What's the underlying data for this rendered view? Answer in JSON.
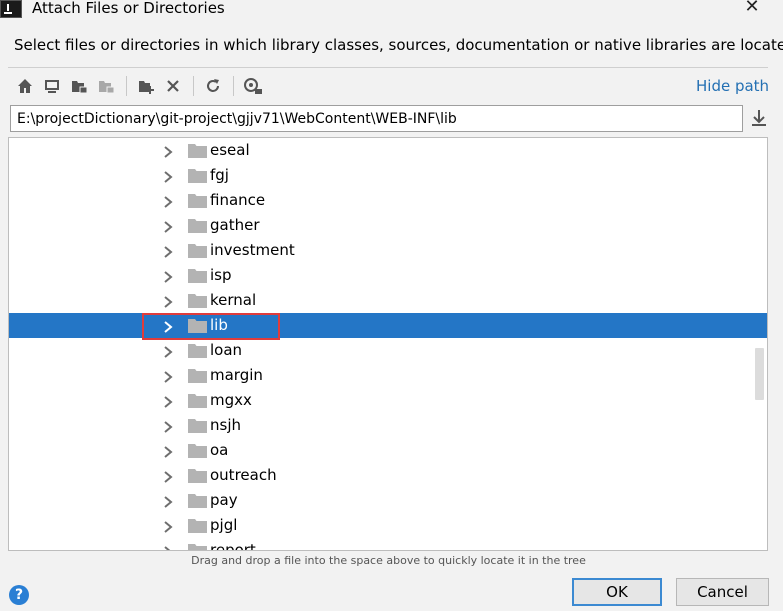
{
  "window": {
    "title": "Attach Files or Directories",
    "close_glyph": "✕"
  },
  "description": "Select files or directories in which library classes, sources, documentation or native libraries are located",
  "toolbar": {
    "icons": [
      "home-icon",
      "desktop-icon",
      "project-folder-icon",
      "module-folder-icon",
      "new-folder-icon",
      "delete-icon",
      "refresh-icon",
      "show-hidden-icon"
    ],
    "hide_path_label": "Hide path"
  },
  "path": {
    "value": "E:\\projectDictionary\\git-project\\gjjv71\\WebContent\\WEB-INF\\lib"
  },
  "tree": {
    "items": [
      {
        "label": "eseal"
      },
      {
        "label": "fgj"
      },
      {
        "label": "finance"
      },
      {
        "label": "gather"
      },
      {
        "label": "investment"
      },
      {
        "label": "isp"
      },
      {
        "label": "kernal"
      },
      {
        "label": "lib",
        "selected": true
      },
      {
        "label": "loan"
      },
      {
        "label": "margin"
      },
      {
        "label": "mgxx"
      },
      {
        "label": "nsjh"
      },
      {
        "label": "oa"
      },
      {
        "label": "outreach"
      },
      {
        "label": "pay"
      },
      {
        "label": "pjgl"
      },
      {
        "label": "report"
      }
    ]
  },
  "hint": "Drag and drop a file into the space above to quickly locate it in the tree",
  "footer": {
    "help_glyph": "?",
    "ok_label": "OK",
    "cancel_label": "Cancel"
  },
  "colors": {
    "selection": "#2476c6",
    "link": "#2470b3",
    "highlight_border": "#e03c3c",
    "folder": "#b3b3b3"
  }
}
